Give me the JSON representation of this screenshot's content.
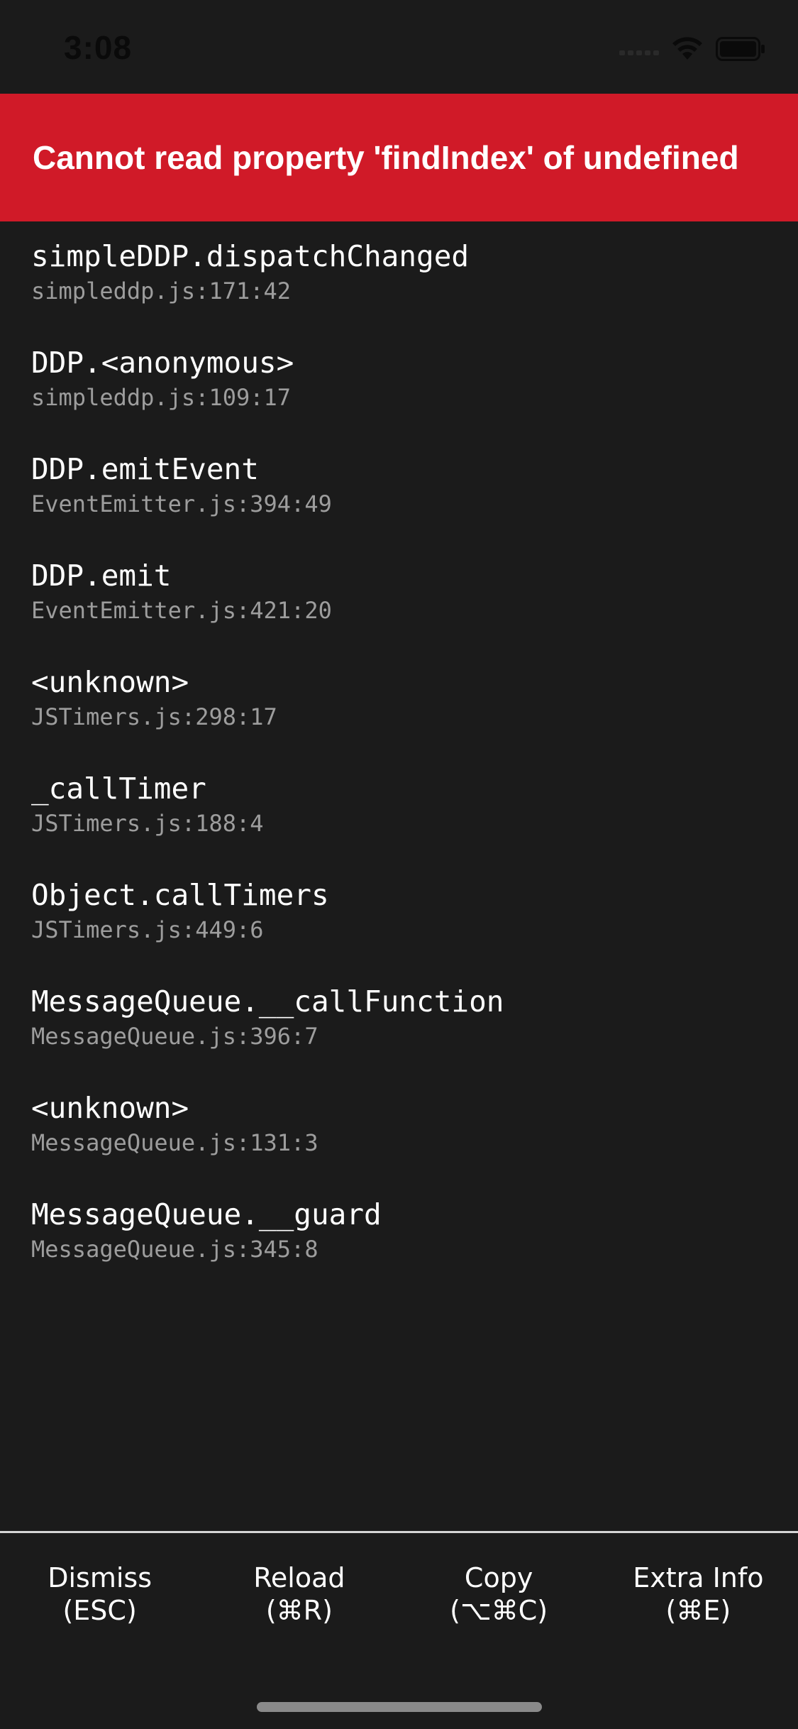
{
  "status_bar": {
    "time": "3:08"
  },
  "error": {
    "message": "Cannot read property 'findIndex' of undefined"
  },
  "stack": [
    {
      "method": "simpleDDP.dispatchChanged",
      "location": "simpleddp.js:171:42"
    },
    {
      "method": "DDP.<anonymous>",
      "location": "simpleddp.js:109:17"
    },
    {
      "method": "DDP.emitEvent",
      "location": "EventEmitter.js:394:49"
    },
    {
      "method": "DDP.emit",
      "location": "EventEmitter.js:421:20"
    },
    {
      "method": "<unknown>",
      "location": "JSTimers.js:298:17"
    },
    {
      "method": "_callTimer",
      "location": "JSTimers.js:188:4"
    },
    {
      "method": "Object.callTimers",
      "location": "JSTimers.js:449:6"
    },
    {
      "method": "MessageQueue.__callFunction",
      "location": "MessageQueue.js:396:7"
    },
    {
      "method": "<unknown>",
      "location": "MessageQueue.js:131:3"
    },
    {
      "method": "MessageQueue.__guard",
      "location": "MessageQueue.js:345:8"
    }
  ],
  "footer": {
    "dismiss": {
      "label": "Dismiss",
      "shortcut": "(ESC)"
    },
    "reload": {
      "label": "Reload",
      "shortcut": "(⌘R)"
    },
    "copy": {
      "label": "Copy",
      "shortcut": "(⌥⌘C)"
    },
    "extra_info": {
      "label": "Extra Info",
      "shortcut": "(⌘E)"
    }
  },
  "icons": {
    "signal": "cellular-signal-icon",
    "wifi": "wifi-icon",
    "battery": "battery-icon"
  }
}
